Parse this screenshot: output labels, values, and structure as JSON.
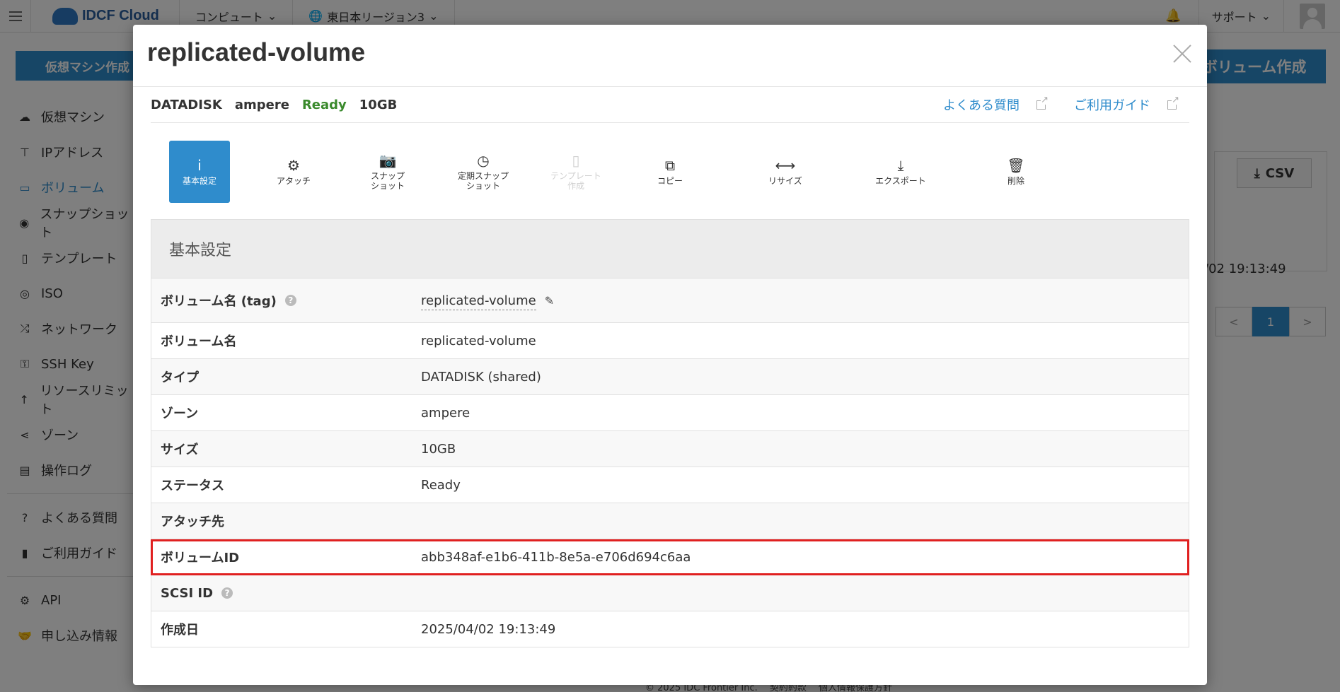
{
  "topbar": {
    "logo": "IDCF Cloud",
    "compute": "コンピュート",
    "region": "東日本リージョン3",
    "support": "サポート"
  },
  "sidebar": {
    "create_vm": "仮想マシン作成",
    "items": [
      {
        "label": "仮想マシン",
        "icon": "cloud-icon"
      },
      {
        "label": "IPアドレス",
        "icon": "sitemap-icon"
      },
      {
        "label": "ボリューム",
        "icon": "hdd-icon"
      },
      {
        "label": "スナップショット",
        "icon": "camera-icon"
      },
      {
        "label": "テンプレート",
        "icon": "file-icon"
      },
      {
        "label": "ISO",
        "icon": "disc-icon"
      },
      {
        "label": "ネットワーク",
        "icon": "random-icon"
      },
      {
        "label": "SSH Key",
        "icon": "key-icon"
      },
      {
        "label": "リソースリミット",
        "icon": "level-up-icon"
      },
      {
        "label": "ゾーン",
        "icon": "share-icon"
      },
      {
        "label": "操作ログ",
        "icon": "log-icon"
      }
    ],
    "help_items": [
      {
        "label": "よくある質問",
        "icon": "question-icon"
      },
      {
        "label": "ご利用ガイド",
        "icon": "book-icon"
      }
    ],
    "bottom_items": [
      {
        "label": "API",
        "icon": "cogs-icon"
      },
      {
        "label": "申し込み情報",
        "icon": "handshake-icon"
      }
    ]
  },
  "background": {
    "create_volume": "ボリューム作成",
    "csv": "CSV",
    "date": "/02 19:13:49",
    "page": "1",
    "prev": "<",
    "next": ">",
    "footer": "© 2025 IDC Frontier Inc.　 契約約款　 個人情報保護方針"
  },
  "modal": {
    "title": "replicated-volume",
    "summary": {
      "type": "DATADISK",
      "zone": "ampere",
      "status": "Ready",
      "size": "10GB"
    },
    "links": {
      "faq": "よくある質問",
      "guide": "ご利用ガイド"
    },
    "actions": [
      {
        "line1": "基本設定",
        "line2": "",
        "icon": "info-icon",
        "glyph": "i",
        "active": true
      },
      {
        "line1": "アタッチ",
        "line2": "",
        "icon": "gear-icon",
        "glyph": "⚙"
      },
      {
        "line1": "スナップ",
        "line2": "ショット",
        "icon": "camera-icon",
        "glyph": "📷"
      },
      {
        "line1": "定期スナップ",
        "line2": "ショット",
        "icon": "clock-icon",
        "glyph": "◷"
      },
      {
        "line1": "テンプレート",
        "line2": "作成",
        "icon": "file-icon",
        "glyph": "▯",
        "disabled": true
      },
      {
        "line1": "コピー",
        "line2": "",
        "icon": "copy-icon",
        "glyph": "⧉"
      },
      {
        "line1": "リサイズ",
        "line2": "",
        "icon": "arrows-h-icon",
        "glyph": "⟷"
      },
      {
        "line1": "エクスポート",
        "line2": "",
        "icon": "download-icon",
        "glyph": "⤓"
      },
      {
        "line1": "削除",
        "line2": "",
        "icon": "trash-icon",
        "glyph": "🗑"
      }
    ],
    "settings_title": "基本設定",
    "rows": {
      "tag_label": "ボリューム名 (tag)",
      "tag_value": "replicated-volume",
      "name_label": "ボリューム名",
      "name_value": "replicated-volume",
      "type_label": "タイプ",
      "type_value": "DATADISK (shared)",
      "zone_label": "ゾーン",
      "zone_value": "ampere",
      "size_label": "サイズ",
      "size_value": "10GB",
      "status_label": "ステータス",
      "status_value": "Ready",
      "attach_label": "アタッチ先",
      "attach_value": "",
      "id_label": "ボリュームID",
      "id_value": "abb348af-e1b6-411b-8e5a-e706d694c6aa",
      "scsi_label": "SCSI ID",
      "scsi_value": "",
      "created_label": "作成日",
      "created_value": "2025/04/02 19:13:49"
    }
  },
  "colors": {
    "accent": "#2f8ccc",
    "ready": "#3a8a2c",
    "highlight": "#e02020"
  }
}
